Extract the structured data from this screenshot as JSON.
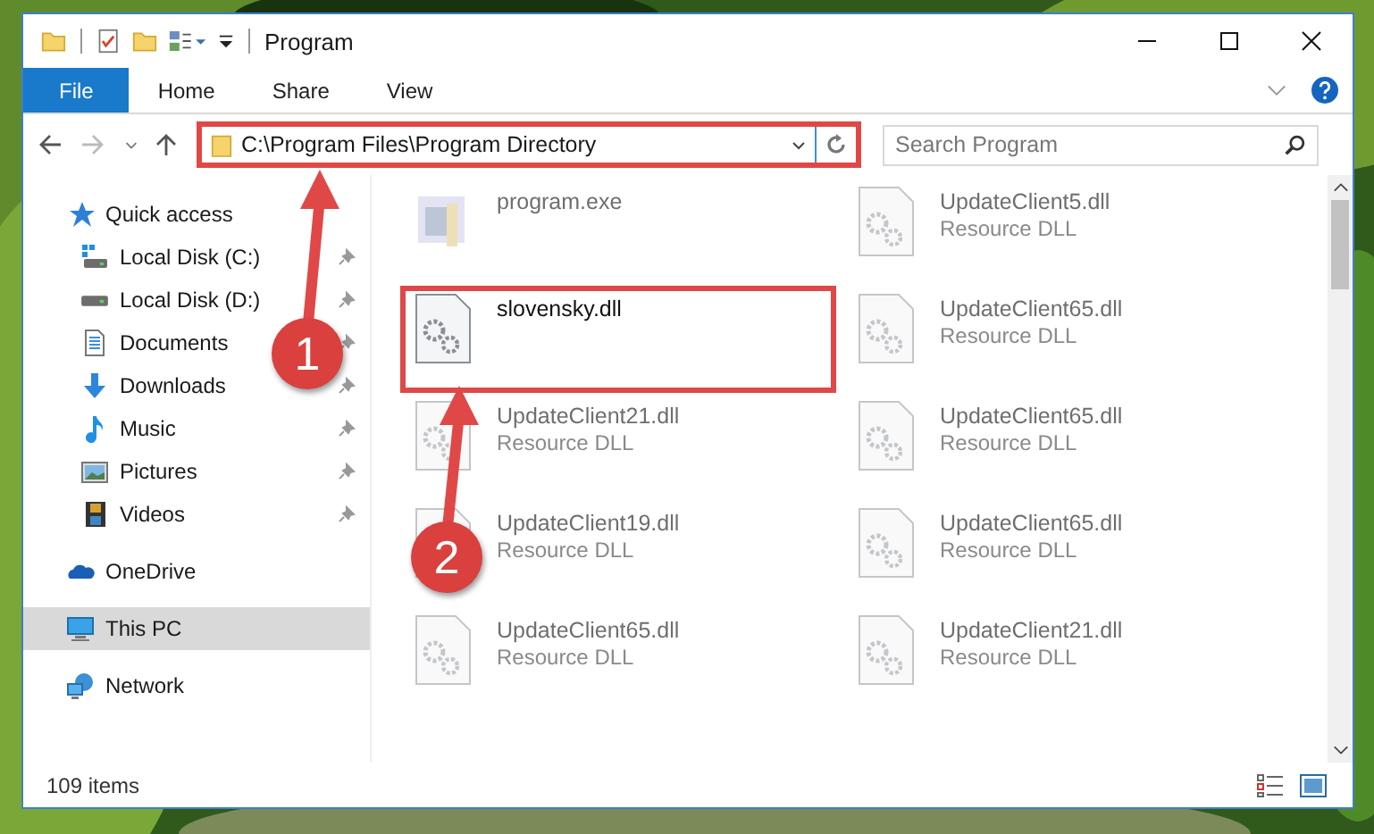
{
  "window": {
    "title": "Program"
  },
  "ribbon_tabs": [
    {
      "label": "File",
      "selected": true
    },
    {
      "label": "Home",
      "selected": false
    },
    {
      "label": "Share",
      "selected": false
    },
    {
      "label": "View",
      "selected": false
    }
  ],
  "address_bar": {
    "value": "C:\\Program Files\\Program Directory",
    "highlighted": true
  },
  "search": {
    "placeholder": "Search Program"
  },
  "sidebar": {
    "items": [
      {
        "label": "Quick access",
        "kind": "star",
        "selected": false,
        "children": [
          {
            "label": "Local Disk (C:)",
            "kind": "system-drive",
            "pinned": true
          },
          {
            "label": "Local Disk (D:)",
            "kind": "drive",
            "pinned": true
          },
          {
            "label": "Documents",
            "kind": "document",
            "pinned": true
          },
          {
            "label": "Downloads",
            "kind": "download",
            "pinned": true
          },
          {
            "label": "Music",
            "kind": "music",
            "pinned": true
          },
          {
            "label": "Pictures",
            "kind": "pictures",
            "pinned": true
          },
          {
            "label": "Videos",
            "kind": "film",
            "pinned": true
          }
        ]
      },
      {
        "label": "OneDrive",
        "kind": "cloud",
        "selected": false
      },
      {
        "label": "This PC",
        "kind": "computer",
        "selected": true
      },
      {
        "label": "Network",
        "kind": "network",
        "selected": false
      }
    ]
  },
  "files": [
    {
      "name": "program.exe",
      "kind": "exe",
      "blurred": true,
      "highlighted": false
    },
    {
      "name": "UpdateClient5.dll",
      "type": "Resource DLL",
      "kind": "dll",
      "blurred": true,
      "highlighted": false
    },
    {
      "name": "slovensky.dll",
      "kind": "dll",
      "blurred": false,
      "highlighted": true
    },
    {
      "name": "UpdateClient65.dll",
      "type": "Resource DLL",
      "kind": "dll",
      "blurred": true,
      "highlighted": false
    },
    {
      "name": "UpdateClient21.dll",
      "type": "Resource DLL",
      "kind": "dll",
      "blurred": true,
      "highlighted": false
    },
    {
      "name": "UpdateClient65.dll",
      "type": "Resource DLL",
      "kind": "dll",
      "blurred": true,
      "highlighted": false
    },
    {
      "name": "UpdateClient19.dll",
      "type": "Resource DLL",
      "kind": "dll",
      "blurred": true,
      "highlighted": false
    },
    {
      "name": "UpdateClient65.dll",
      "type": "Resource DLL",
      "kind": "dll",
      "blurred": true,
      "highlighted": false
    },
    {
      "name": "UpdateClient65.dll",
      "type": "Resource DLL",
      "kind": "dll",
      "blurred": true,
      "highlighted": false
    },
    {
      "name": "UpdateClient21.dll",
      "type": "Resource DLL",
      "kind": "dll",
      "blurred": true,
      "highlighted": false
    }
  ],
  "status_bar": {
    "item_count": "109 items"
  },
  "annotations": [
    {
      "number": "1"
    },
    {
      "number": "2"
    }
  ]
}
